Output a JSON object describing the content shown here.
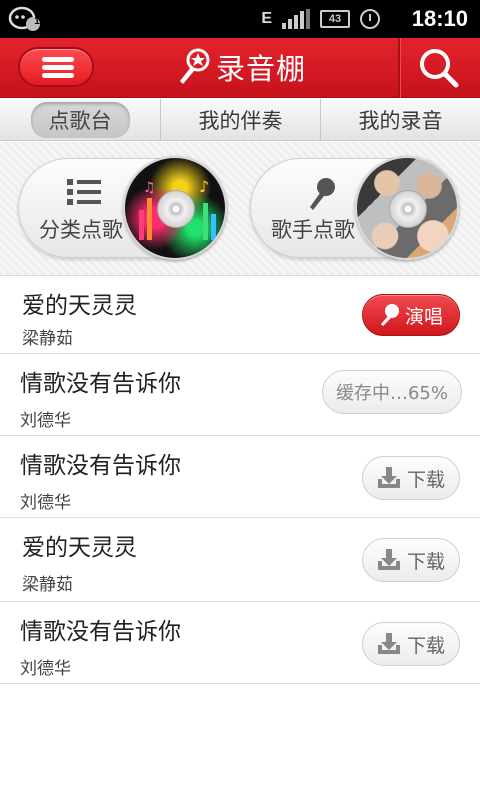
{
  "status_bar": {
    "notification_count": "1",
    "network": "E",
    "battery": "43",
    "time": "18:10"
  },
  "header": {
    "title": "录音棚",
    "menu_icon": "hamburger-menu-icon",
    "logo_icon": "microphone-star-icon",
    "search_icon": "search-icon",
    "accent_color": "#d81c24"
  },
  "tabs": [
    {
      "label": "点歌台",
      "active": true
    },
    {
      "label": "我的伴奏",
      "active": false
    },
    {
      "label": "我的录音",
      "active": false
    }
  ],
  "categories": [
    {
      "label": "分类点歌",
      "icon": "list-icon"
    },
    {
      "label": "歌手点歌",
      "icon": "microphone-icon"
    }
  ],
  "songs": [
    {
      "title": "爱的天灵灵",
      "artist": "梁静茹",
      "action": "演唱",
      "action_type": "sing"
    },
    {
      "title": "情歌没有告诉你",
      "artist": "刘德华",
      "action": "缓存中…65%",
      "action_type": "caching",
      "progress": 65
    },
    {
      "title": "情歌没有告诉你",
      "artist": "刘德华",
      "action": "下载",
      "action_type": "download"
    },
    {
      "title": "爱的天灵灵",
      "artist": "梁静茹",
      "action": "下载",
      "action_type": "download"
    },
    {
      "title": "情歌没有告诉你",
      "artist": "刘德华",
      "action": "下载",
      "action_type": "download"
    }
  ]
}
